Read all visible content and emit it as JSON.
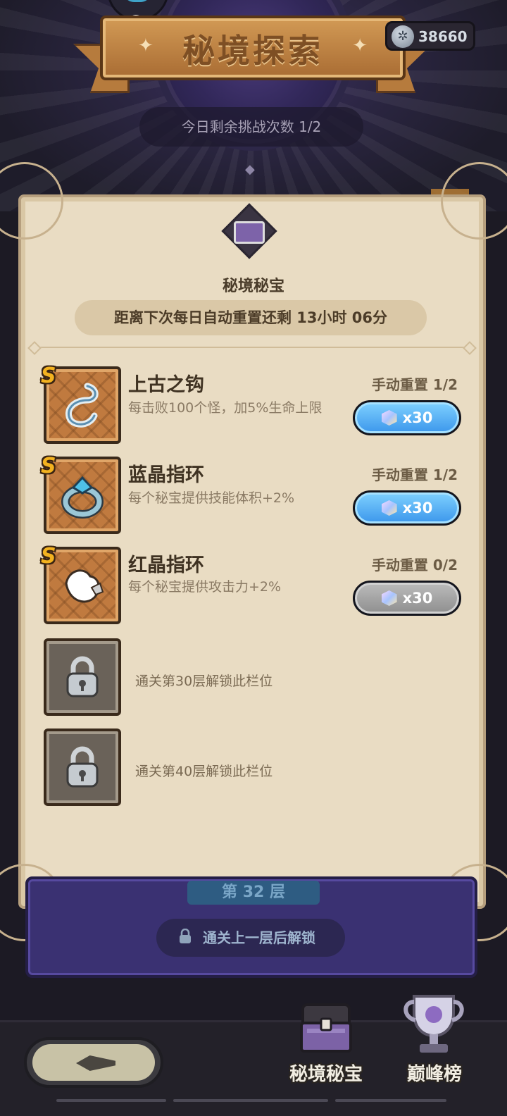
{
  "header": {
    "title": "秘境探索",
    "currency_value": "38660",
    "attempts_text": "今日剩余挑战次数 1/2"
  },
  "treasure_panel": {
    "title": "秘境秘宝",
    "reset_countdown": "距离下次每日自动重置还剩 13小时 06分",
    "items": [
      {
        "rank": "S",
        "name": "上古之钩",
        "desc": "每击败100个怪，加5%生命上限",
        "reset_label": "手动重置 1/2",
        "cost": "x30",
        "button_state": "active"
      },
      {
        "rank": "S",
        "name": "蓝晶指环",
        "desc": "每个秘宝提供技能体积+2%",
        "reset_label": "手动重置 1/2",
        "cost": "x30",
        "button_state": "active"
      },
      {
        "rank": "S",
        "name": "红晶指环",
        "desc": "每个秘宝提供攻击力+2%",
        "reset_label": "手动重置 0/2",
        "cost": "x30",
        "button_state": "disabled"
      }
    ],
    "locked_slots": [
      {
        "text": "通关第30层解锁此栏位"
      },
      {
        "text": "通关第40层解锁此栏位"
      }
    ]
  },
  "floor": {
    "label": "第 32 层",
    "unlock_text": "通关上一层后解锁"
  },
  "bottom_nav": {
    "treasure_label": "秘境秘宝",
    "ranking_label": "巅峰榜"
  },
  "colors": {
    "button_active": "#3b96eb",
    "button_disabled": "#8e8e8e",
    "panel_bg": "#e9dcc3",
    "rank_badge": "#f3b21f"
  }
}
